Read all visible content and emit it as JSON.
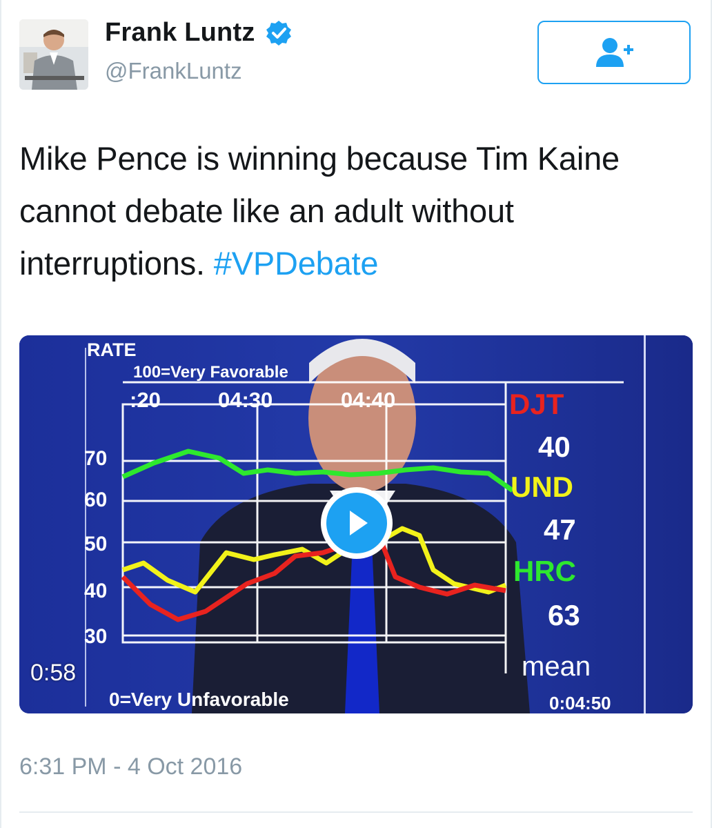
{
  "user": {
    "name": "Frank Luntz",
    "handle": "@FrankLuntz",
    "verified": true,
    "avatar_icon": "profile-photo"
  },
  "follow_button": {
    "icon": "add-user-icon",
    "color": "#1da1f2"
  },
  "tweet": {
    "text": "Mike Pence is winning because Tim Kaine cannot debate like an adult without interruptions.",
    "hashtag": "#VPDebate",
    "timestamp": "6:31 PM - 4 Oct 2016"
  },
  "video": {
    "duration": "0:58",
    "play_icon": "play-icon",
    "overlay": {
      "rate_label": "RATE",
      "top_scale": "100=Very Favorable",
      "bottom_scale": "0=Very Unfavorable",
      "time_ticks": [
        ":20",
        "04:30",
        "04:40"
      ],
      "y_ticks": [
        "70",
        "60",
        "50",
        "40",
        "30"
      ],
      "legend": [
        {
          "label": "DJT",
          "value": "40",
          "color": "#e8231f"
        },
        {
          "label": "UND",
          "value": "47",
          "color": "#f2f21a"
        },
        {
          "label": "HRC",
          "value": "63",
          "color": "#2ee82e"
        }
      ],
      "mean_label": "mean",
      "clock": "0:04:50"
    }
  },
  "colors": {
    "accent": "#1da1f2",
    "secondary_text": "#8899a6"
  }
}
